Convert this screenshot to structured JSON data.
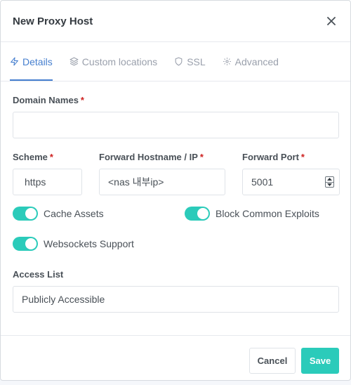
{
  "modal": {
    "title": "New Proxy Host"
  },
  "tabs": [
    {
      "label": "Details",
      "icon": "lightning-bolt-icon",
      "active": true
    },
    {
      "label": "Custom locations",
      "icon": "layers-icon",
      "active": false
    },
    {
      "label": "SSL",
      "icon": "shield-icon",
      "active": false
    },
    {
      "label": "Advanced",
      "icon": "gear-icon",
      "active": false
    }
  ],
  "form": {
    "domain_names": {
      "label": "Domain Names",
      "required_mark": "*",
      "value": ""
    },
    "scheme": {
      "label": "Scheme",
      "required_mark": "*",
      "value": "https"
    },
    "forward_hostname": {
      "label": "Forward Hostname / IP",
      "required_mark": "*",
      "value": "<nas 내부ip>"
    },
    "forward_port": {
      "label": "Forward Port",
      "required_mark": "*",
      "value": "5001"
    },
    "cache_assets": {
      "label": "Cache Assets",
      "enabled": true
    },
    "block_exploits": {
      "label": "Block Common Exploits",
      "enabled": true
    },
    "websockets": {
      "label": "Websockets Support",
      "enabled": true
    },
    "access_list": {
      "label": "Access List",
      "value": "Publicly Accessible"
    }
  },
  "footer": {
    "cancel_label": "Cancel",
    "save_label": "Save"
  },
  "colors": {
    "accent_blue": "#467fcf",
    "toggle_teal": "#2bcbba",
    "required_red": "#cd201f"
  }
}
